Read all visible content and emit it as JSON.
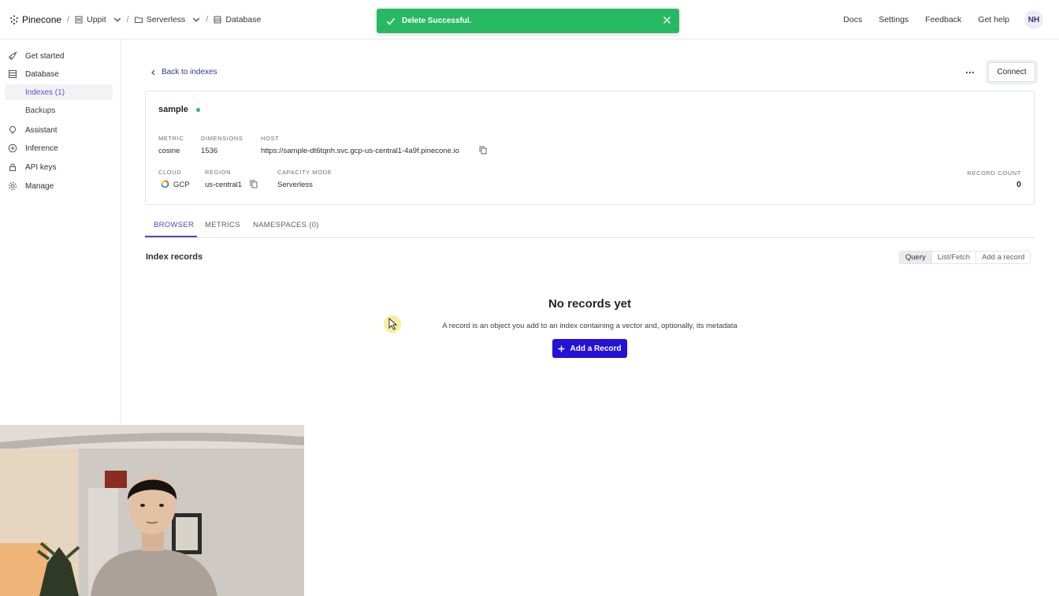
{
  "header": {
    "brand": "Pinecone",
    "breadcrumbs": [
      "Uppit",
      "Serverless",
      "Database"
    ],
    "nav": [
      "Docs",
      "Settings",
      "Feedback",
      "Get help"
    ],
    "avatar_initials": "NH"
  },
  "toast": {
    "message": "Delete Successful.",
    "color": "#27b863"
  },
  "sidebar": {
    "items": [
      {
        "label": "Get started",
        "icon": "rocket-icon"
      },
      {
        "label": "Database",
        "icon": "database-icon"
      },
      {
        "label": "Assistant",
        "icon": "bulb-icon"
      },
      {
        "label": "Inference",
        "icon": "plus-circle-icon"
      },
      {
        "label": "API keys",
        "icon": "lock-icon"
      },
      {
        "label": "Manage",
        "icon": "gear-icon"
      }
    ],
    "sub_items": [
      "Indexes (1)",
      "Backups"
    ],
    "active_sub": "Indexes (1)"
  },
  "main": {
    "back_label": "Back to indexes",
    "connect_label": "Connect",
    "index": {
      "name": "sample",
      "status_color": "#2bb673",
      "metric_label": "METRIC",
      "metric": "cosine",
      "dimensions_label": "DIMENSIONS",
      "dimensions": "1536",
      "host_label": "HOST",
      "host": "https://sample-dt6tqnh.svc.gcp-us-central1-4a9f.pinecone.io",
      "cloud_label": "CLOUD",
      "cloud": "GCP",
      "region_label": "REGION",
      "region": "us-central1",
      "capacity_label": "CAPACITY MODE",
      "capacity": "Serverless",
      "record_count_label": "RECORD COUNT",
      "record_count": "0"
    },
    "tabs": [
      "BROWSER",
      "METRICS",
      "NAMESPACES (0)"
    ],
    "active_tab": "BROWSER",
    "section_title": "Index records",
    "segments": [
      "Query",
      "List/Fetch",
      "Add a record"
    ],
    "empty_title": "No records yet",
    "empty_desc": "A record is an object you add to an index containing a vector and, optionally, its metadata",
    "add_record_label": "Add a Record",
    "accent": "#2512d6"
  }
}
